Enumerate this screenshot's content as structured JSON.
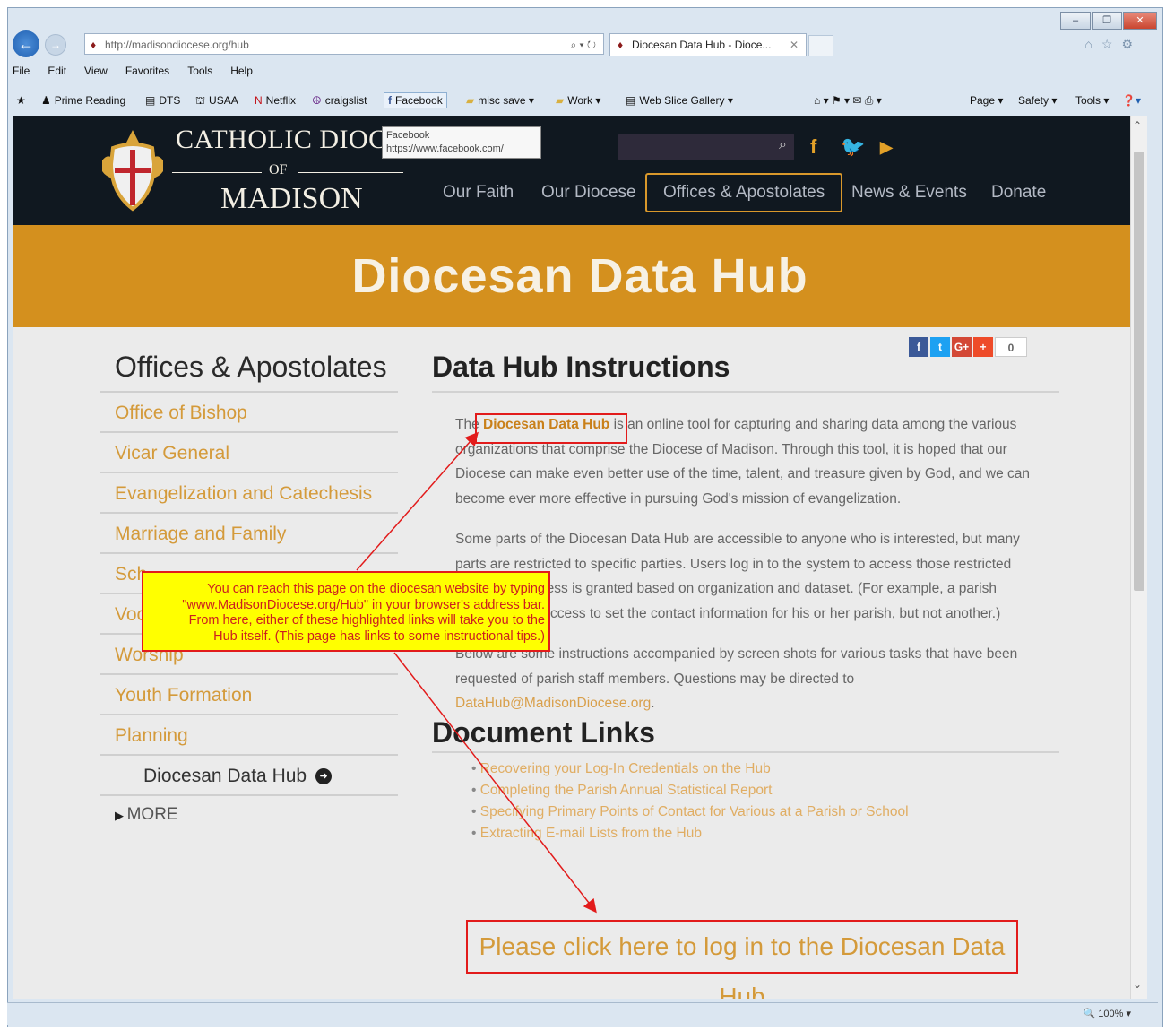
{
  "browser": {
    "address": "http://madisondiocese.org/hub",
    "tab_title": "Diocesan Data Hub - Dioce...",
    "menu": [
      "File",
      "Edit",
      "View",
      "Favorites",
      "Tools",
      "Help"
    ],
    "favorites": [
      {
        "label": "Prime Reading",
        "icon": "person-icon"
      },
      {
        "label": "DTS",
        "icon": "page-icon"
      },
      {
        "label": "USAA",
        "icon": "usaa-icon"
      },
      {
        "label": "Netflix",
        "icon": "netflix-icon"
      },
      {
        "label": "craigslist",
        "icon": "peace-icon"
      },
      {
        "label": "Facebook",
        "icon": "facebook-icon"
      },
      {
        "label": "misc save ▾",
        "icon": "folder-icon"
      },
      {
        "label": "Work ▾",
        "icon": "folder-icon"
      },
      {
        "label": "Web Slice Gallery ▾",
        "icon": "page-icon"
      }
    ],
    "command_bar": [
      "Page ▾",
      "Safety ▾",
      "Tools ▾"
    ],
    "tooltip": {
      "title": "Facebook",
      "url": "https://www.facebook.com/"
    },
    "zoom": "100%"
  },
  "site": {
    "brand_line1": "CATHOLIC DIOCES",
    "brand_line2": "OF",
    "brand_line3": "MADISON",
    "nav": [
      "Our Faith",
      "Our Diocese",
      "Offices & Apostolates",
      "News & Events",
      "Donate"
    ],
    "banner_title": "Diocesan Data Hub",
    "share_count": "0",
    "sidebar": {
      "title": "Offices & Apostolates",
      "items": [
        "Office of Bishop",
        "Vicar General",
        "Evangelization and Catechesis",
        "Marriage and Family",
        "Sch",
        "Voc",
        "Worship",
        "Youth Formation",
        "Planning"
      ],
      "subitem": "Diocesan Data Hub",
      "more": "MORE"
    },
    "content": {
      "title": "Data Hub Instructions",
      "p1_pre": "The ",
      "p1_hl": "Diocesan Data Hub",
      "p1_post": " is an online tool for capturing and sharing data among the various organizations that comprise the Diocese of Madison. Through this tool, it is hoped that our Diocese can make even better use of the time, talent, and treasure given by God, and we can become ever more effective in pursuing God's mission of evangelization.",
      "p2": "Some parts of the Diocesan Data Hub are accessible to anyone who is interested, but many parts are restricted to specific parties. Users log in to the system to access those restricted areas, and access is granted based on organization and dataset. (For example, a parish secretary has access to set the contact information for his or her parish, but not another.)",
      "p3_pre": "Below are some instructions accompanied by screen shots for various tasks that have been requested of parish staff members. Questions may be directed to ",
      "p3_link": "DataHub@MadisonDiocese.org",
      "p3_post": ".",
      "doc_title": "Document Links",
      "doc_links": [
        "Recovering your Log-In Credentials on the Hub",
        "Completing the Parish Annual Statistical Report",
        "Specifying Primary Points of Contact for Various at a Parish or School",
        "Extracting E-mail Lists from the Hub"
      ],
      "login_link": "Please click here to log in to the Diocesan Data Hub"
    }
  },
  "annotation": {
    "line1": "You can reach this page on the diocesan website by typing",
    "line2": "\"www.MadisonDiocese.org/Hub\" in your browser's address bar.",
    "line3": "From here, either of these highlighted links will take you to the",
    "line4": "Hub itself.  (This page has links to some instructional tips.)",
    "color_box": "#ffff00",
    "color_border": "#e21b1b"
  }
}
